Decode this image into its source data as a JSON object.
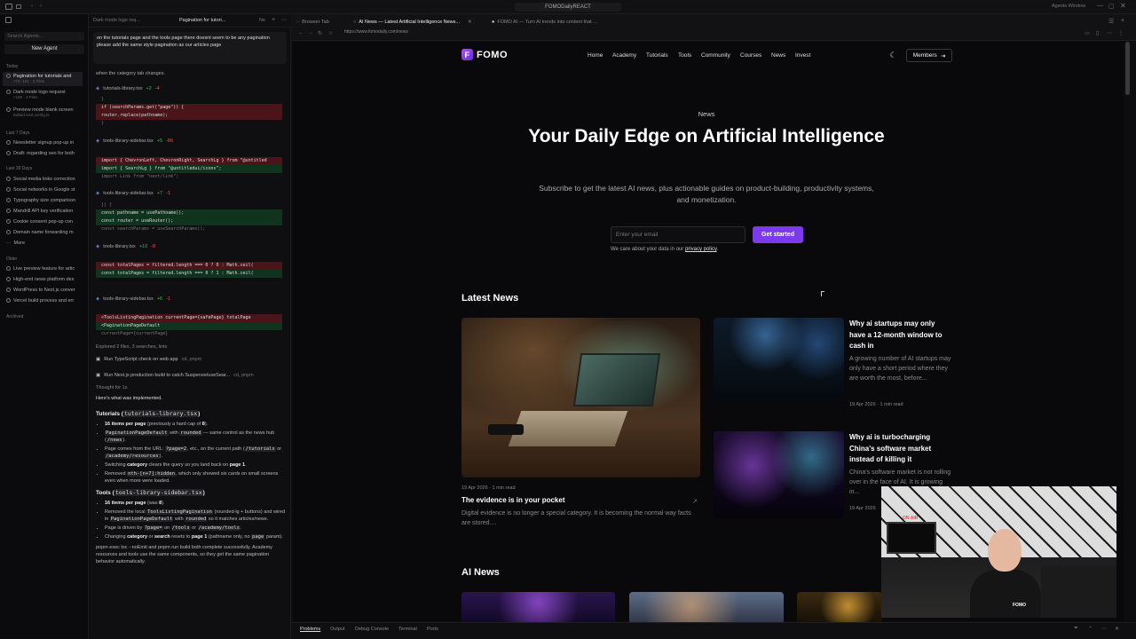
{
  "window": {
    "title": "FOMODailyREACT",
    "right_label": "Agents Window"
  },
  "agents": {
    "search_placeholder": "Search Agents...",
    "new_agent": "New Agent",
    "groups": {
      "today": "Today",
      "last7": "Last 7 Days",
      "last30": "Last 30 Days",
      "older": "Older",
      "archived": "Archived",
      "more": "More"
    },
    "today": [
      {
        "label": "Pagination for tutorials and",
        "sub": "+74 -101 · 3 Files"
      },
      {
        "label": "Dark mode logo request",
        "sub": "+160 · 3 Files"
      },
      {
        "label": "Preview mode blank screen",
        "sub": "Edited next.config.ts"
      }
    ],
    "last7": [
      "Newsletter signup pop-up in",
      "Draft: regarding seo for both"
    ],
    "last30": [
      "Social media links correction",
      "Social networks in Google st",
      "Typography size comparison",
      "Mandrill API key verification",
      "Cookie consent pop-up con",
      "Domain name forwarding m"
    ],
    "older": [
      "Live preview feature for artic",
      "High-end news platform des",
      "WordPress to Next.js conver",
      "Vercel build process and err"
    ]
  },
  "chat": {
    "tabs": [
      "Dark mode logo req...",
      "Pagination for tutori...",
      "Ne"
    ],
    "prompt": "on the tutorials page and the tools page there doesnt seem to be any pagination please add the same style pagination as our articles page",
    "above_text": "when the category tab changes.",
    "diffs": [
      {
        "file": "tutorials-library.tsx",
        "add": "+2",
        "del": "-4",
        "lines": [
          {
            "t": "n",
            "c": "}"
          },
          {
            "t": "r",
            "c": "if (searchParams.get(\"page\")) {"
          },
          {
            "t": "r",
            "c": "  router.replace(pathname);"
          },
          {
            "t": "n",
            "c": "}"
          }
        ]
      },
      {
        "file": "tools-library-sidebar.tsx",
        "add": "+5",
        "del": "-86",
        "lines": [
          {
            "t": "r",
            "c": "import { ChevronLeft, ChevronRight, SearchLg } from \"@untitled"
          },
          {
            "t": "a",
            "c": "import { SearchLg } from \"@untitledui/icons\";"
          },
          {
            "t": "n",
            "c": "import Link from \"next/link\";"
          }
        ]
      },
      {
        "file": "tools-library-sidebar.tsx",
        "add": "+7",
        "del": "-1",
        "lines": [
          {
            "t": "n",
            "c": "}) {"
          },
          {
            "t": "a",
            "c": "  const pathname = usePathname();"
          },
          {
            "t": "a",
            "c": "  const router = useRouter();"
          },
          {
            "t": "n",
            "c": "  const searchParams = useSearchParams();"
          }
        ]
      },
      {
        "file": "tools-library.tsx",
        "add": "+10",
        "del": "-8",
        "lines": [
          {
            "t": "r",
            "c": "  const totalPages = filtered.length === 0 ? 0 : Math.ceil("
          },
          {
            "t": "a",
            "c": "  const totalPages = filtered.length === 0 ? 1 : Math.ceil("
          }
        ]
      },
      {
        "file": "tools-library-sidebar.tsx",
        "add": "+6",
        "del": "-1",
        "lines": [
          {
            "t": "r",
            "c": "<ToolsListingPagination currentPage={safePage} totalPage"
          },
          {
            "t": "a",
            "c": "<PaginationPageDefault"
          },
          {
            "t": "n",
            "c": "  currentPage={currentPage}"
          }
        ]
      }
    ],
    "explored": "Explored 2 files, 3 searches, lints",
    "run1": {
      "label": "Run TypeScript check on web app",
      "detail": "cd, pnpm"
    },
    "run2": {
      "label": "Run Next.js production build to catch Suspense/useSear...",
      "detail": "cd, pnpm"
    },
    "thought": "Thought for 1s",
    "implemented": "Here's what was implemented.",
    "tutorials_heading": "Tutorials (",
    "tutorials_file": "tutorials-library.tsx",
    "tools_heading": "Tools (",
    "tools_file": "tools-library-sidebar.tsx",
    "footer": "pnpm exec tsc --noEmit and pnpm run build both complete successfully. Academy resources and tools use the same components, so they get the same pagination behavior automatically."
  },
  "browser": {
    "tabs": [
      "Browser Tab",
      "AI News — Latest Artificial Intelligence News...",
      "FOMO AI — Turn AI trends into content that ..."
    ],
    "url": "https://www.fomodaily.com/news"
  },
  "site": {
    "brand": "FOMO",
    "nav": [
      "Home",
      "Academy",
      "Tutorials",
      "Tools",
      "Community",
      "Courses",
      "News",
      "Invest"
    ],
    "members": "Members",
    "eyebrow": "News",
    "title": "Your Daily Edge on Artificial Intelligence",
    "subtitle": "Subscribe to get the latest AI news, plus actionable guides on product-building, productivity systems, and monetization.",
    "email_placeholder": "Enter your email",
    "cta": "Get started",
    "fine_print": "We care about your data in our",
    "privacy": "privacy policy",
    "latest_heading": "Latest News",
    "feature": {
      "meta": "19 Apr 2026 · 1 min read",
      "title": "The evidence is in your pocket",
      "excerpt": "Digital evidence is no longer a special category. It is becoming the normal way facts are stored...."
    },
    "side_cards": [
      {
        "title": "Why ai startups may only have a 12-month window to cash in",
        "excerpt": "A growing number of AI startups may only have a short period where they are worth the most, before...",
        "meta": "19 Apr 2026 · 1 min read"
      },
      {
        "title": "Why ai is turbocharging China's software market instead of killing it",
        "excerpt": "China's software market is not rolling over in the face of AI. It is growing in...",
        "meta": "19 Apr 2026"
      }
    ],
    "ai_news_heading": "AI News"
  },
  "bottom": {
    "tabs": [
      "Problems",
      "Output",
      "Debug Console",
      "Terminal",
      "Ports"
    ]
  },
  "webcam": {
    "sign": "ON AIR",
    "logo": "FOMO"
  }
}
